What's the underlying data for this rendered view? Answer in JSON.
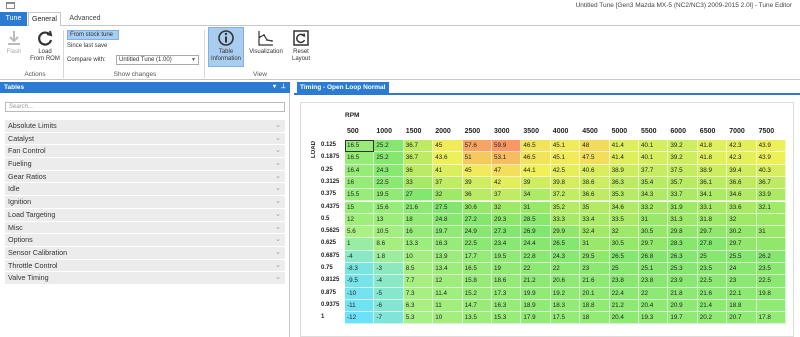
{
  "window": {
    "title": "Untitled Tune [Gen3 Mazda MX-5 (NC2/NC3) 2009-2015 2.0l] - Tune Editor"
  },
  "ribbon_tabs": [
    "Tune",
    "General",
    "Advanced"
  ],
  "ribbon": {
    "actions": {
      "flash_label": "Flash",
      "load_label": "Load\nFrom ROM",
      "group_label": "Actions"
    },
    "show_changes": {
      "from_stock_label": "From stock tune",
      "since_last_save_label": "Since last save",
      "compare_with_label": "Compare with:",
      "compare_value": "Untitled Tune (1.00)",
      "group_label": "Show changes"
    },
    "view": {
      "table_info_label": "Table\nInformation",
      "visualization_label": "Visualization",
      "reset_layout_label": "Reset\nLayout",
      "group_label": "View"
    }
  },
  "tables_panel": {
    "header": "Tables",
    "search_placeholder": "Search...",
    "categories": [
      "Absolute Limits",
      "Catalyst",
      "Fan Control",
      "Fueling",
      "Gear Ratios",
      "Idle",
      "Ignition",
      "Load Targeting",
      "Misc",
      "Options",
      "Sensor Calibration",
      "Throttle Control",
      "Valve Timing"
    ]
  },
  "table_view": {
    "tab_title": "Timing - Open Loop Normal",
    "x_axis_label": "RPM",
    "y_axis_label": "LOAD",
    "rpm": [
      "500",
      "1000",
      "1500",
      "2000",
      "2500",
      "3000",
      "3500",
      "4000",
      "4500",
      "5000",
      "5500",
      "6000",
      "6500",
      "7000",
      "7500"
    ],
    "load": [
      "0.125",
      "0.1875",
      "0.25",
      "0.3125",
      "0.375",
      "0.4375",
      "0.5",
      "0.5625",
      "0.625",
      "0.6875",
      "0.75",
      "0.8125",
      "0.875",
      "0.9375",
      "1"
    ],
    "values": [
      [
        "16.5",
        "25.2",
        "36.7",
        "45",
        "57.6",
        "59.9",
        "46.5",
        "45.1",
        "48",
        "41.4",
        "40.1",
        "39.2",
        "41.8",
        "42.3",
        "43.9"
      ],
      [
        "16.5",
        "25.2",
        "36.7",
        "43.6",
        "51",
        "53.1",
        "46.5",
        "45.1",
        "47.5",
        "41.4",
        "40.1",
        "39.2",
        "41.8",
        "42.3",
        "43.9"
      ],
      [
        "16.4",
        "24.3",
        "36",
        "41",
        "45",
        "47",
        "44.1",
        "42.5",
        "40.6",
        "38.9",
        "37.7",
        "37.5",
        "38.9",
        "39.4",
        "40.3"
      ],
      [
        "16",
        "22.5",
        "33",
        "37",
        "39",
        "42",
        "39",
        "39.8",
        "38.6",
        "36.3",
        "35.4",
        "35.7",
        "36.1",
        "36.6",
        "36.7"
      ],
      [
        "15.5",
        "19.5",
        "27",
        "32",
        "36",
        "37",
        "34",
        "37.2",
        "36.6",
        "35.3",
        "34.3",
        "33.7",
        "34.1",
        "34.6",
        "33.9"
      ],
      [
        "15",
        "15.6",
        "21.6",
        "27.5",
        "30.6",
        "32",
        "31",
        "35.2",
        "35",
        "34.6",
        "33.2",
        "31.9",
        "33.1",
        "33.6",
        "32.1"
      ],
      [
        "12",
        "13",
        "18",
        "24.8",
        "27.2",
        "29.3",
        "28.5",
        "33.3",
        "33.4",
        "33.5",
        "31",
        "31.3",
        "31.8",
        "32",
        ""
      ],
      [
        "5.6",
        "10.5",
        "16",
        "19.7",
        "24.9",
        "27.3",
        "26.9",
        "29.9",
        "32.4",
        "32",
        "30.5",
        "29.8",
        "29.7",
        "30.2",
        "31"
      ],
      [
        "1",
        "8.6",
        "13.3",
        "16.3",
        "22.5",
        "23.4",
        "24.4",
        "26.5",
        "31",
        "30.5",
        "29.7",
        "28.3",
        "27.8",
        "29.7",
        ""
      ],
      [
        "-4",
        "1.8",
        "10",
        "13.9",
        "17.7",
        "19.5",
        "22.8",
        "24.3",
        "29.5",
        "26.5",
        "26.8",
        "26.3",
        "25",
        "25.5",
        "26.2"
      ],
      [
        "-8.3",
        "-3",
        "8.5",
        "13.4",
        "16.5",
        "19",
        "22",
        "22",
        "23",
        "25",
        "25.1",
        "25.3",
        "23.5",
        "24",
        "23.5"
      ],
      [
        "-9.5",
        "-4",
        "7.7",
        "12",
        "15.8",
        "18.6",
        "21.2",
        "20.6",
        "21.6",
        "23.8",
        "23.8",
        "23.9",
        "22.5",
        "23",
        "22.5"
      ],
      [
        "-10",
        "-5",
        "7.3",
        "11.4",
        "15.2",
        "17.3",
        "19.9",
        "19.2",
        "20.1",
        "22.4",
        "22",
        "21.8",
        "21.6",
        "22.1",
        "19.8"
      ],
      [
        "-11",
        "-6",
        "6.3",
        "11",
        "14.7",
        "16.3",
        "18.9",
        "18.3",
        "18.8",
        "21.2",
        "20.4",
        "20.9",
        "21.4",
        "18.8",
        ""
      ],
      [
        "-12",
        "-7",
        "5.3",
        "10",
        "13.5",
        "15.3",
        "17.9",
        "17.5",
        "18",
        "20.4",
        "19.3",
        "19.7",
        "20.2",
        "20.7",
        "17.8"
      ]
    ]
  }
}
